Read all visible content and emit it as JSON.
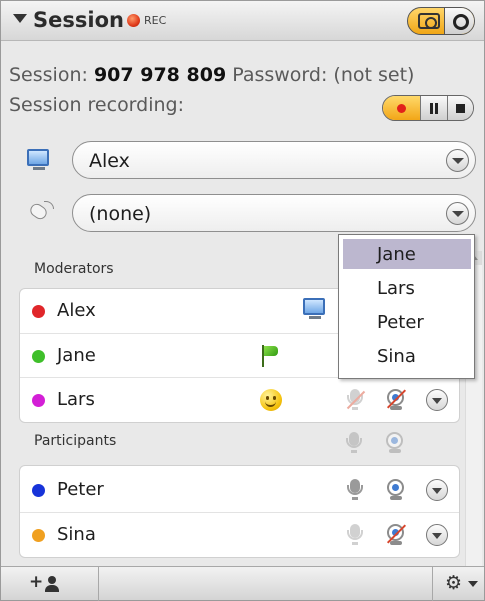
{
  "header": {
    "title": "Session",
    "rec_label": "REC"
  },
  "session": {
    "session_label": "Session:",
    "session_id": "907 978 809",
    "password_label": "Password:",
    "password_value": "(not set)",
    "recording_label": "Session recording:"
  },
  "controls": {
    "screen_presenter": "Alex",
    "mouse_control": "(none)"
  },
  "moderators": {
    "label": "Moderators",
    "rows": [
      {
        "name": "Alex",
        "color": "#e0262a"
      },
      {
        "name": "Jane",
        "color": "#3fbf2a"
      },
      {
        "name": "Lars",
        "color": "#d31fd6"
      }
    ]
  },
  "participants": {
    "label": "Participants",
    "rows": [
      {
        "name": "Peter",
        "color": "#1733d9"
      },
      {
        "name": "Sina",
        "color": "#f0a020"
      }
    ]
  },
  "dropdown_menu": {
    "items": [
      "Jane",
      "Lars",
      "Peter",
      "Sina"
    ],
    "selected": "Jane"
  },
  "footer": {
    "add_label": "+",
    "gear_symbol": "⚙"
  }
}
